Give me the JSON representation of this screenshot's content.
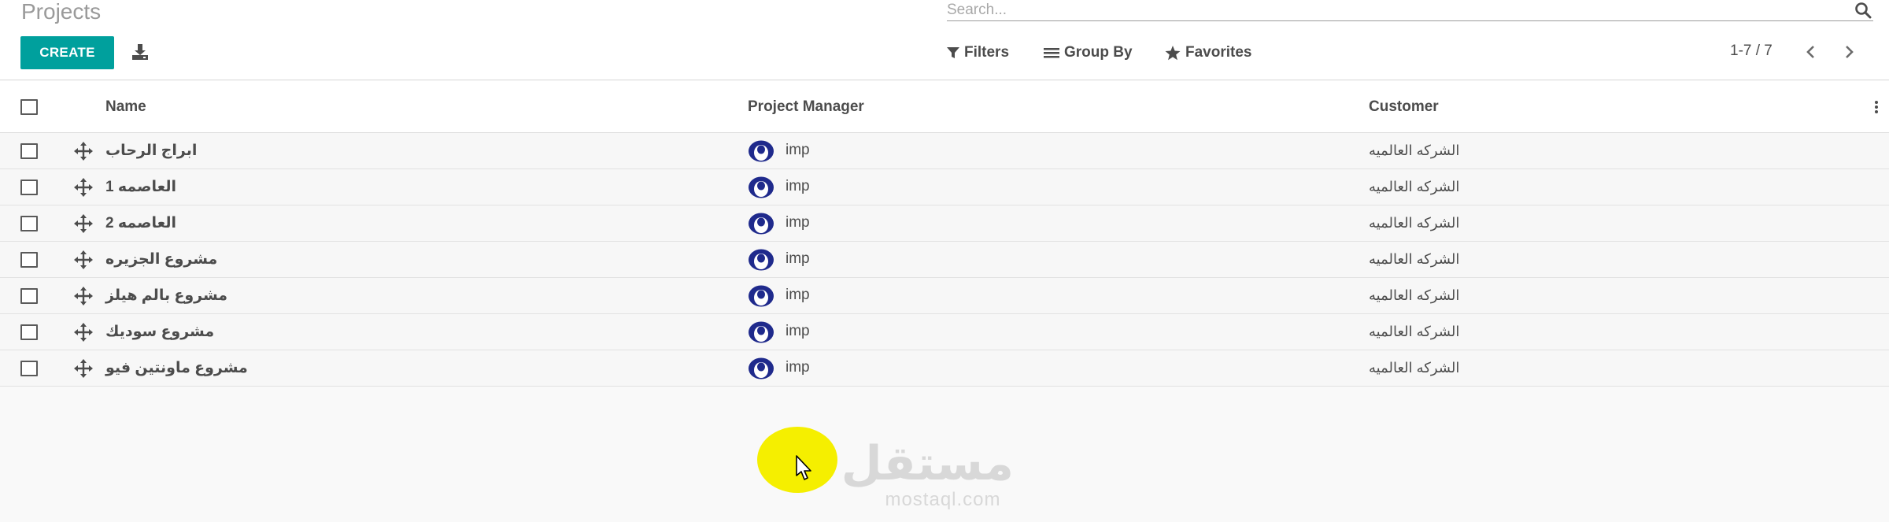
{
  "breadcrumb": {
    "title": "Projects"
  },
  "search": {
    "placeholder": "Search...",
    "value": ""
  },
  "toolbar": {
    "create_label": "CREATE"
  },
  "search_options": {
    "filters_label": "Filters",
    "group_by_label": "Group By",
    "favorites_label": "Favorites"
  },
  "pager": {
    "value": "1-7 / 7"
  },
  "list": {
    "columns": {
      "name": "Name",
      "project_manager": "Project Manager",
      "customer": "Customer"
    },
    "rows": [
      {
        "name": "ابراج الرحاب",
        "project_manager": "imp",
        "customer": "الشركه العالميه"
      },
      {
        "name": "العاصمه 1",
        "project_manager": "imp",
        "customer": "الشركه العالميه"
      },
      {
        "name": "العاصمه 2",
        "project_manager": "imp",
        "customer": "الشركه العالميه"
      },
      {
        "name": "مشروع الجزيره",
        "project_manager": "imp",
        "customer": "الشركه العالميه"
      },
      {
        "name": "مشروع بالم هيلز",
        "project_manager": "imp",
        "customer": "الشركه العالميه"
      },
      {
        "name": "مشروع سوديك",
        "project_manager": "imp",
        "customer": "الشركه العالميه"
      },
      {
        "name": "مشروع ماونتين فيو",
        "project_manager": "imp",
        "customer": "الشركه العالميه"
      }
    ]
  },
  "watermark": {
    "logo": "مستقل",
    "url": "mostaql.com"
  },
  "colors": {
    "primary": "#00a09d",
    "avatar": "#1f2a8c",
    "highlight": "#f5ef00"
  },
  "icons": {
    "search": "search-icon",
    "download": "download-icon",
    "filter": "filter-icon",
    "group_by": "list-icon",
    "favorites": "star-icon",
    "handle": "drag-handle-icon",
    "avatar": "user-avatar-icon",
    "options": "vertical-dots-icon"
  }
}
